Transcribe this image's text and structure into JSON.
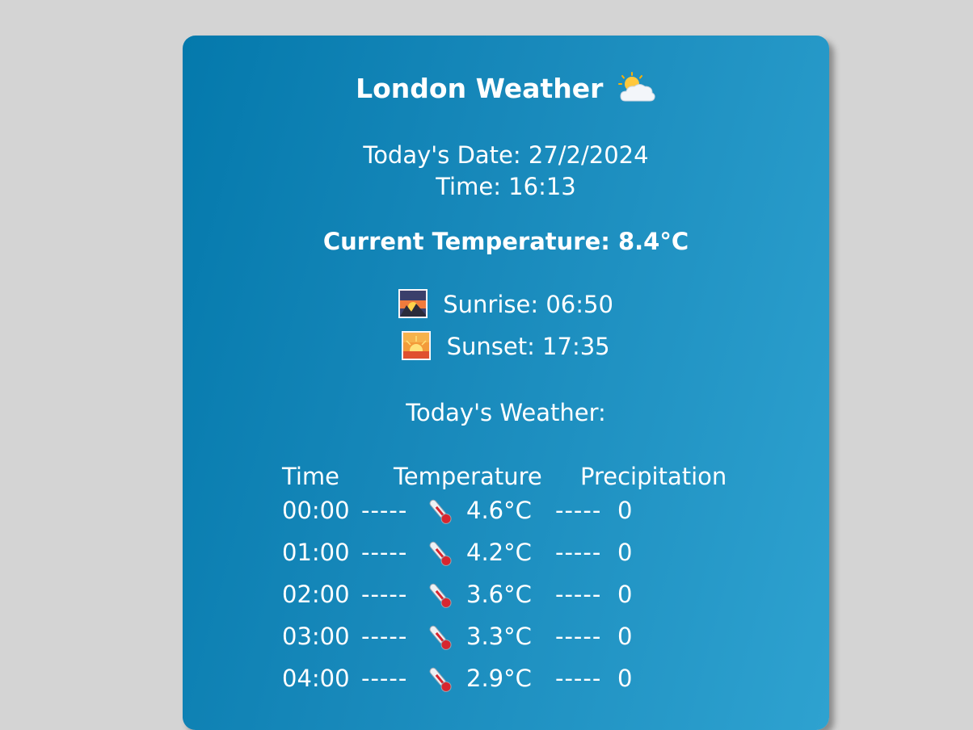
{
  "header": {
    "title": "London Weather",
    "title_icon": "sun-behind-cloud-icon"
  },
  "date_info": {
    "date_text": "Today's Date: 27/2/2024",
    "time_text": "Time: 16:13"
  },
  "current": {
    "temperature_text": "Current Temperature: 8.4°C"
  },
  "sun": {
    "sunrise_text": "Sunrise: 06:50",
    "sunrise_icon": "sunrise-over-mountains-icon",
    "sunset_text": "Sunset: 17:35",
    "sunset_icon": "sunset-icon"
  },
  "forecast": {
    "heading": "Today's Weather:",
    "columns": [
      "Time",
      "Temperature",
      "Precipitation"
    ],
    "separator": "-----",
    "row_icon": "thermometer-icon",
    "rows": [
      {
        "time": "00:00",
        "temperature": "4.6°C",
        "precipitation": "0"
      },
      {
        "time": "01:00",
        "temperature": "4.2°C",
        "precipitation": "0"
      },
      {
        "time": "02:00",
        "temperature": "3.6°C",
        "precipitation": "0"
      },
      {
        "time": "03:00",
        "temperature": "3.3°C",
        "precipitation": "0"
      },
      {
        "time": "04:00",
        "temperature": "2.9°C",
        "precipitation": "0"
      }
    ]
  },
  "colors": {
    "page_background": "#d4d4d4",
    "card_gradient_start": "#0479ac",
    "card_gradient_end": "#2ea2d0",
    "text": "#ffffff"
  }
}
